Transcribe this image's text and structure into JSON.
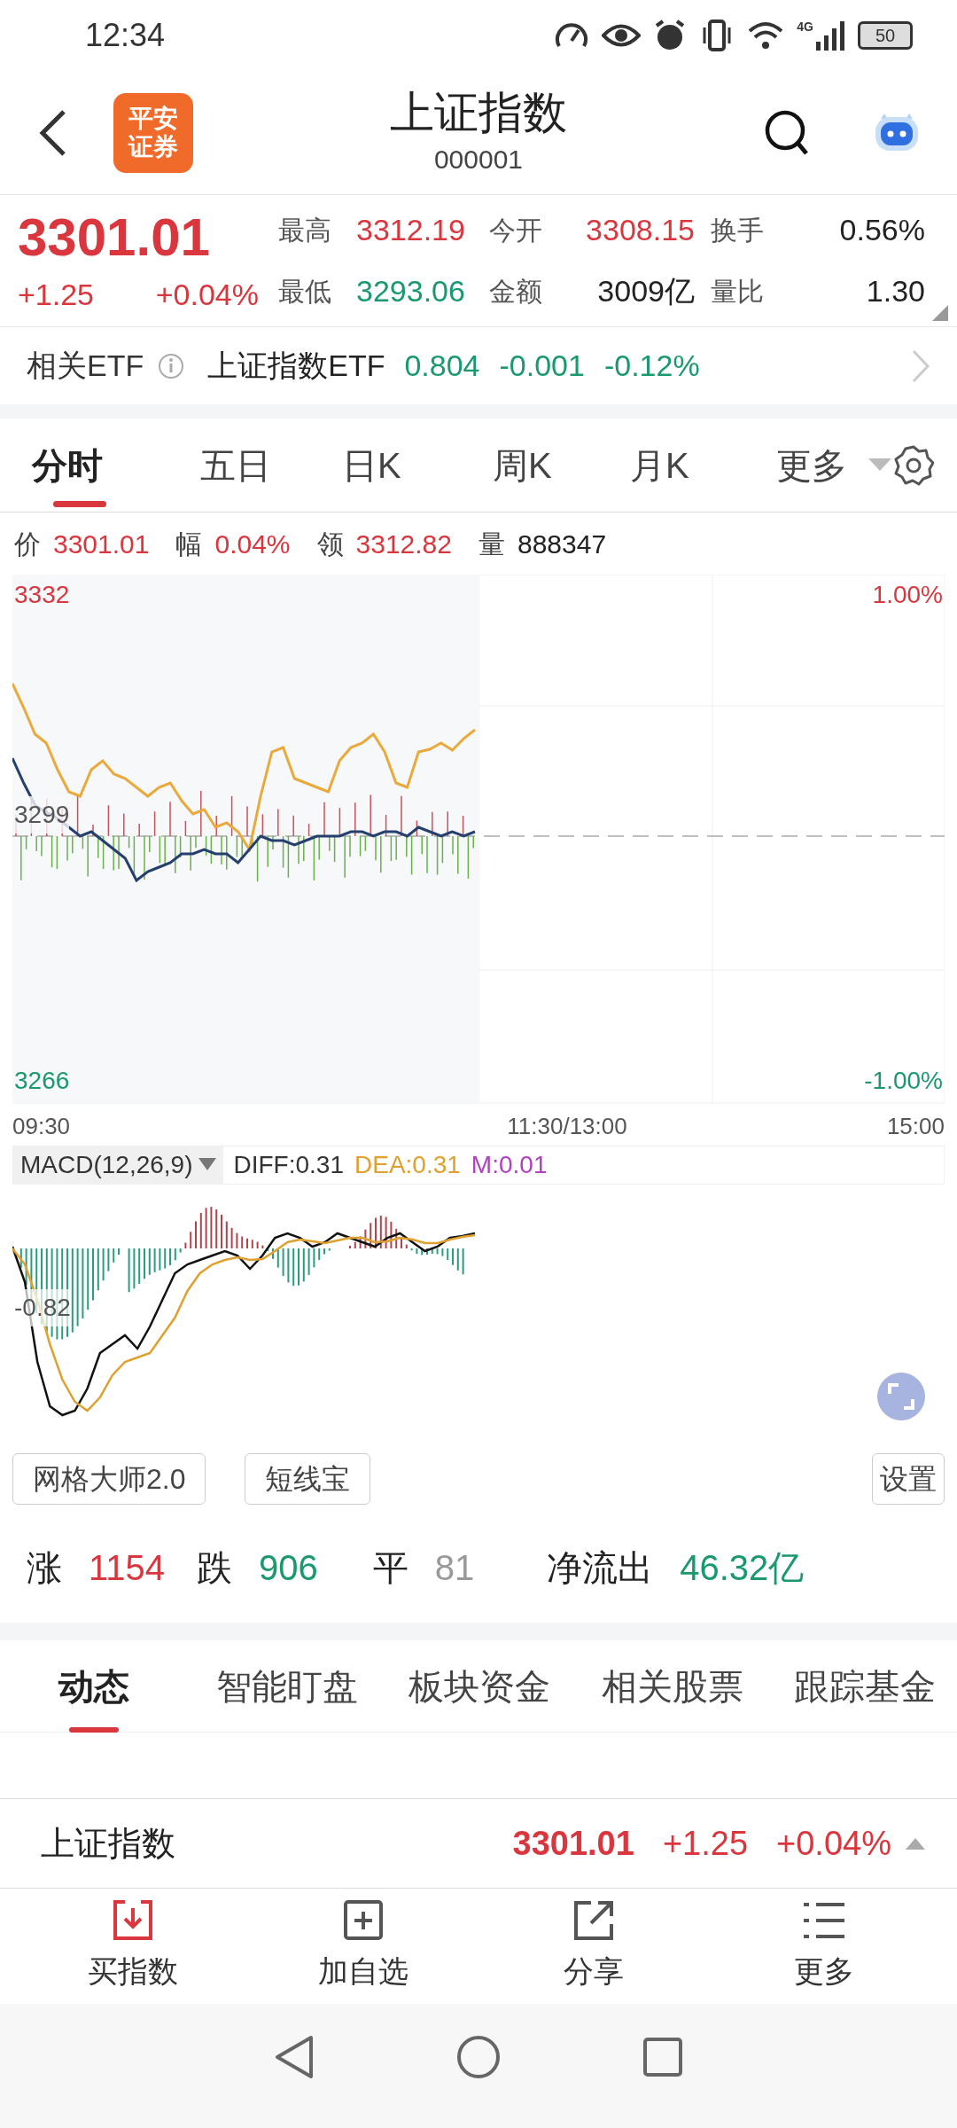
{
  "status_bar": {
    "time": "12:34",
    "network": "4G",
    "battery": "50"
  },
  "header": {
    "logo_lines": [
      "平安",
      "证券"
    ],
    "title": "上证指数",
    "code": "000001"
  },
  "quote": {
    "price": "3301.01",
    "change": "+1.25",
    "change_pct": "+0.04%",
    "stats": [
      {
        "label": "最高",
        "value": "3312.19",
        "color": "#d9363e"
      },
      {
        "label": "今开",
        "value": "3308.15",
        "color": "#d9363e"
      },
      {
        "label": "换手",
        "value": "0.56%",
        "color": "#222222"
      },
      {
        "label": "最低",
        "value": "3293.06",
        "color": "#1a9a6c"
      },
      {
        "label": "金额",
        "value": "3009亿",
        "color": "#222222"
      },
      {
        "label": "量比",
        "value": "1.30",
        "color": "#222222"
      }
    ]
  },
  "etf": {
    "label": "相关ETF",
    "name": "上证指数ETF",
    "price": "0.804",
    "change": "-0.001",
    "change_pct": "-0.12%"
  },
  "chart_tabs": [
    {
      "label": "分时",
      "selected": true
    },
    {
      "label": "五日",
      "selected": false
    },
    {
      "label": "日K",
      "selected": false
    },
    {
      "label": "周K",
      "selected": false
    },
    {
      "label": "月K",
      "selected": false
    }
  ],
  "more_tab": {
    "label": "更多"
  },
  "info_line": [
    {
      "label": "价",
      "value": "3301.01",
      "color": "#d9363e"
    },
    {
      "label": "幅",
      "value": "0.04%",
      "color": "#d9363e"
    },
    {
      "label": "领",
      "value": "3312.82",
      "color": "#d9363e"
    },
    {
      "label": "量",
      "value": "888347",
      "color": "#222222"
    }
  ],
  "chart": {
    "top_price": "3332",
    "mid_price": "3299",
    "bottom_price": "3266",
    "top_pct": "1.00%",
    "bottom_pct": "-1.00%",
    "times": [
      "09:30",
      "11:30/13:00",
      "15:00"
    ]
  },
  "macd": {
    "name": "MACD(12,26,9)",
    "axis_label": "-0.82",
    "values": [
      {
        "text": "DIFF:0.31",
        "color": "#333333"
      },
      {
        "text": "DEA:0.31",
        "color": "#e0a030"
      },
      {
        "text": "M:0.01",
        "color": "#b040c0"
      }
    ]
  },
  "tool_buttons": [
    "网格大师2.0",
    "短线宝"
  ],
  "settings_button": "设置",
  "breadth": [
    {
      "label": "涨",
      "value": "1154",
      "color": "#d9363e"
    },
    {
      "label": "跌",
      "value": "906",
      "color": "#1a9a6c"
    },
    {
      "label": "平",
      "value": "81",
      "color": "#999999"
    }
  ],
  "net_flow": {
    "label": "净流出",
    "value": "46.32亿"
  },
  "content_tabs": [
    {
      "label": "动态",
      "selected": true
    },
    {
      "label": "智能盯盘",
      "selected": false
    },
    {
      "label": "板块资金",
      "selected": false
    },
    {
      "label": "相关股票",
      "selected": false
    },
    {
      "label": "跟踪基金",
      "selected": false
    }
  ],
  "bottom_quote": {
    "name": "上证指数",
    "price": "3301.01",
    "change": "+1.25",
    "change_pct": "+0.04%"
  },
  "actions": [
    {
      "label": "买指数",
      "kind": "buy"
    },
    {
      "label": "加自选",
      "kind": "add"
    },
    {
      "label": "分享",
      "kind": "share"
    },
    {
      "label": "更多",
      "kind": "more"
    }
  ]
}
